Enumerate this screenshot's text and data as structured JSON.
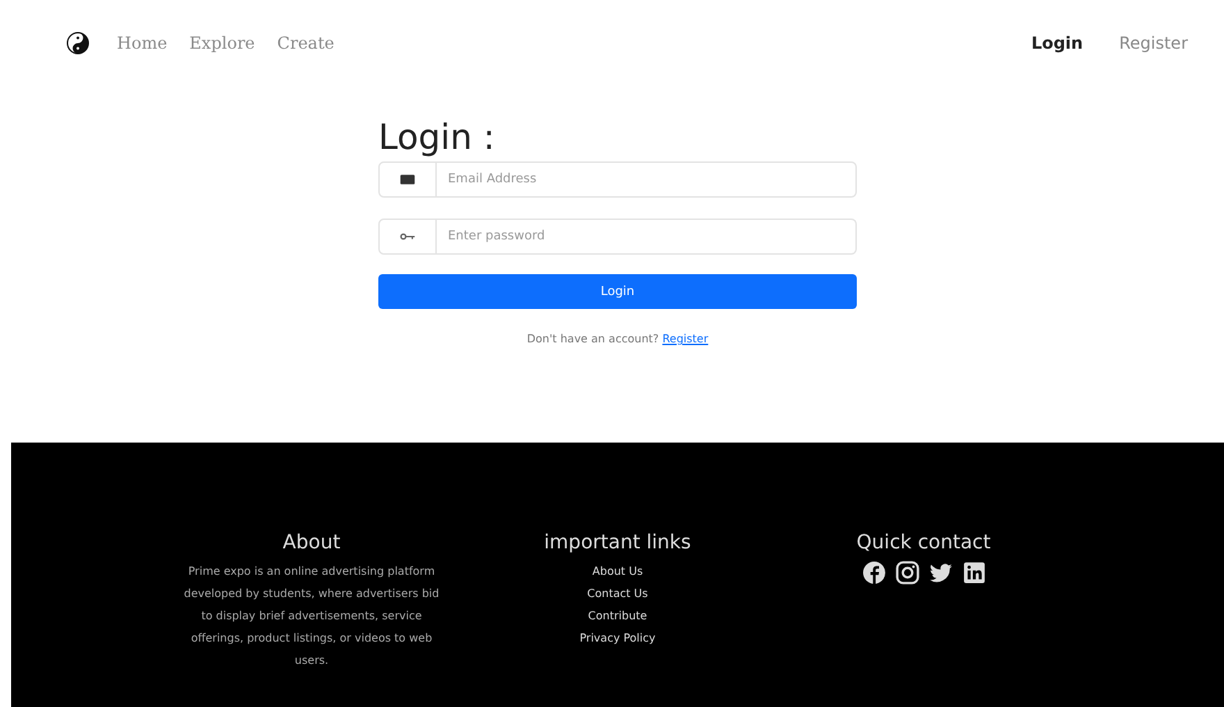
{
  "nav": {
    "links": [
      {
        "label": "Home",
        "selected": false
      },
      {
        "label": "Explore",
        "selected": false
      },
      {
        "label": "Create",
        "selected": false
      }
    ],
    "account": [
      {
        "label": "Login",
        "selected": true
      },
      {
        "label": "Register",
        "selected": false
      }
    ]
  },
  "login": {
    "title": "Login :",
    "email": {
      "placeholder": "Email Address"
    },
    "password": {
      "placeholder": "Enter password"
    },
    "button": "Login",
    "prompt": "Don't have an account?",
    "register_link": "Register"
  },
  "footer": {
    "about": {
      "title": "About",
      "text": "Prime expo is an online advertising platform developed by students, where advertisers bid to display brief advertisements, service offerings, product listings, or videos to web users."
    },
    "links": {
      "title": "important links",
      "items": [
        "About Us",
        "Contact Us",
        "Contribute",
        "Privacy Policy"
      ]
    },
    "contact": {
      "title": "Quick contact",
      "icons": [
        {
          "kind": "facebook"
        },
        {
          "kind": "instagram"
        },
        {
          "kind": "twitter"
        },
        {
          "kind": "linkedin"
        }
      ]
    }
  }
}
